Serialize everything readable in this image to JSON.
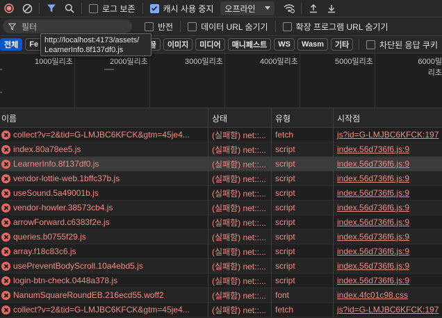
{
  "toolbar": {
    "preserve_log_label": "로그 보존",
    "disable_cache_label": "캐시 사용 중지",
    "throttle_value": "오프라인"
  },
  "filter_bar": {
    "filter_placeholder": "필터",
    "invert_label": "반전",
    "hide_data_urls_label": "데이터 URL 숨기기",
    "hide_extension_urls_label": "확장 프로그램 URL 숨기기"
  },
  "type_filters": {
    "all": "전체",
    "fetch": "Fe",
    "font": "글꼴",
    "img": "이미지",
    "media": "미디어",
    "manifest": "매니페스트",
    "ws": "WS",
    "wasm": "Wasm",
    "other": "기타",
    "blocked_label": "차단된 응답 쿠키"
  },
  "tooltip": {
    "line1": "http://localhost:4173/assets/",
    "line2": "LearnerInfo.8f137df0.js"
  },
  "timeline": {
    "ticks": [
      "1000밀리초",
      "2000밀리초",
      "3000밀리초",
      "4000밀리초",
      "5000밀리초",
      "6000밀리초"
    ]
  },
  "table": {
    "headers": {
      "name": "이름",
      "status": "상태",
      "type": "유형",
      "initiator": "시작점"
    },
    "rows": [
      {
        "name": "collect?v=2&tid=G-LMJBC6KFCK&gtm=45je4...",
        "status": "(실패함) net::...",
        "type": "fetch",
        "initiator": "js?id=G-LMJBC6KFCK:197"
      },
      {
        "name": "index.80a78ee5.js",
        "status": "(실패함) net::...",
        "type": "script",
        "initiator": "index.56d736f6.js:9"
      },
      {
        "name": "LearnerInfo.8f137df0.js",
        "status": "(실패함) net::...",
        "type": "script",
        "initiator": "index.56d736f6.js:9"
      },
      {
        "name": "vendor-lottie-web.1bffc37b.js",
        "status": "(실패함) net::...",
        "type": "script",
        "initiator": "index.56d736f6.js:9"
      },
      {
        "name": "useSound.5a49001b.js",
        "status": "(실패함) net::...",
        "type": "script",
        "initiator": "index.56d736f6.js:9"
      },
      {
        "name": "vendor-howler.38573cb4.js",
        "status": "(실패함) net::...",
        "type": "script",
        "initiator": "index.56d736f6.js:9"
      },
      {
        "name": "arrowForward.c6383f2e.js",
        "status": "(실패함) net::...",
        "type": "script",
        "initiator": "index.56d736f6.js:9"
      },
      {
        "name": "queries.b0755f29.js",
        "status": "(실패함) net::...",
        "type": "script",
        "initiator": "index.56d736f6.js:9"
      },
      {
        "name": "array.f18c83c6.js",
        "status": "(실패함) net::...",
        "type": "script",
        "initiator": "index.56d736f6.js:9"
      },
      {
        "name": "usePreventBodyScroll.10a4ebd5.js",
        "status": "(실패함) net::...",
        "type": "script",
        "initiator": "index.56d736f6.js:9"
      },
      {
        "name": "login-btn-check.0448a378.js",
        "status": "(실패함) net::...",
        "type": "script",
        "initiator": "index.56d736f6.js:9"
      },
      {
        "name": "NanumSquareRoundEB.216ecd55.woff2",
        "status": "(실패함) net::...",
        "type": "font",
        "initiator": "index.4fc01c98.css"
      },
      {
        "name": "collect?v=2&tid=G-LMJBC6KFCK&gtm=45je4...",
        "status": "(실패함) net::...",
        "type": "fetch",
        "initiator": "js?id=G-LMJBC6KFCK:197"
      }
    ]
  },
  "icons": {
    "record": "record-stop-icon",
    "clear": "clear-icon",
    "filter": "filter-icon",
    "search": "search-icon",
    "wifi": "network-conditions-icon",
    "upload": "import-har-icon",
    "download": "export-har-icon",
    "error": "error-icon"
  },
  "colors": {
    "error": "#f28b82",
    "accent": "#7cacf8",
    "active_chip": "#0b57d0"
  }
}
